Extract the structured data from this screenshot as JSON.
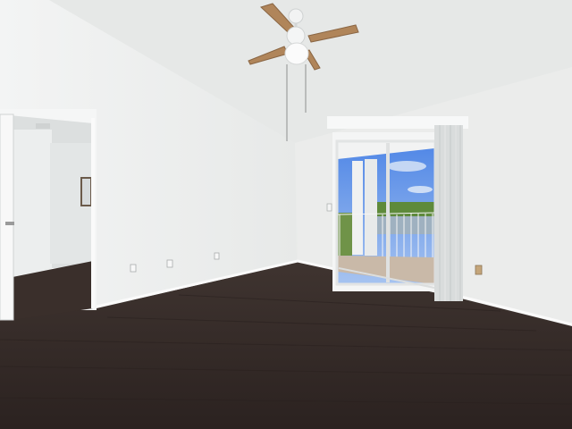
{
  "scene": {
    "colors": {
      "ceiling": "#eceeed",
      "left_wall": "#f1f2f2",
      "right_wall": "#e8eae9",
      "floor": "#3a2f2b",
      "sky": "#6f9be6",
      "water": "#c8d4de",
      "foliage": "#5e8a3b",
      "fan_blade": "#b0855a"
    },
    "icons": [
      "ceiling-fan-icon",
      "outlet-icon",
      "door-handle-icon"
    ]
  }
}
